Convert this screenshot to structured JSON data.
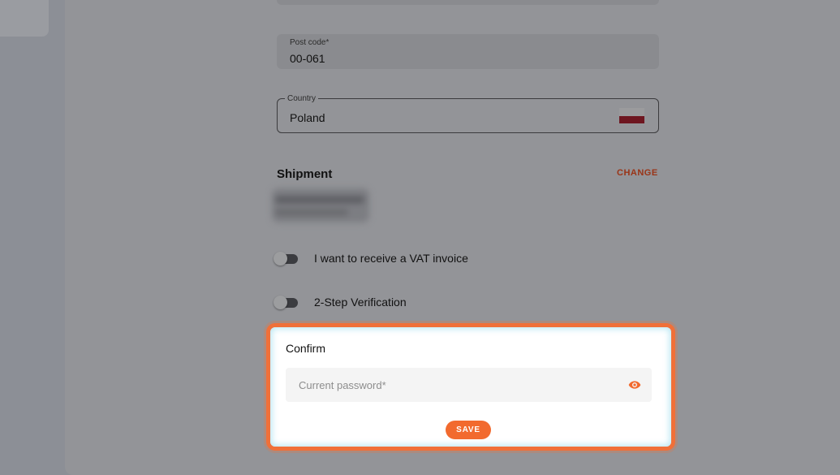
{
  "address": {
    "post_code": {
      "label": "Post code*",
      "value": "00-061"
    },
    "country": {
      "label": "Country",
      "value": "Poland",
      "flag_icon": "poland-flag-icon"
    }
  },
  "shipment": {
    "title": "Shipment",
    "change_label": "CHANGE"
  },
  "toggles": [
    {
      "label": "I want to receive a VAT invoice",
      "checked": false
    },
    {
      "label": "2-Step Verification",
      "checked": false
    }
  ],
  "confirm": {
    "title": "Confirm",
    "password_placeholder": "Current password*",
    "password_value": "",
    "reveal_icon": "eye-icon",
    "save_label": "SAVE"
  },
  "colors": {
    "accent": "#f26a2e",
    "highlight_border": "#f07039",
    "overlay": "#8c8f96"
  }
}
